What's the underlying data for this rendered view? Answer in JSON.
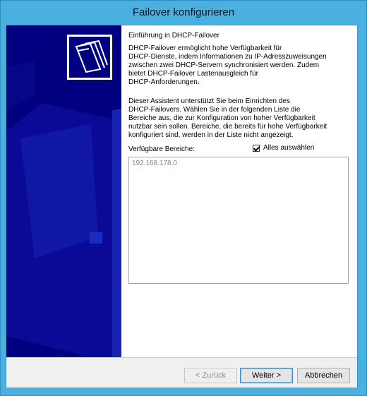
{
  "window": {
    "title": "Failover konfigurieren"
  },
  "intro": {
    "heading": "Einführung in DHCP-Failover",
    "paragraph1_lines": [
      "DHCP-Failover ermöglicht hohe Verfügbarkeit für",
      "DHCP-Dienste, indem Informationen zu IP-Adresszuweisungen",
      "zwischen zwei DHCP-Servern synchronisiert werden. Zudem",
      "bietet DHCP-Failover Lastenausgleich für",
      "DHCP-Anforderungen."
    ],
    "paragraph2_lines": [
      "Dieser Assistent unterstützt Sie beim Einrichten des",
      "DHCP-Failovers. Wählen Sie in der folgenden Liste die",
      "Bereiche aus, die zur Konfiguration von hoher Verfügbarkeit",
      "nutzbar sein sollen. Bereiche, die bereits für hohe Verfügbarkeit",
      "konfiguriert sind, werden in der Liste nicht angezeigt."
    ]
  },
  "scopes": {
    "label": "Verfügbare Bereiche:",
    "select_all_label": "Alles auswählen",
    "select_all_checked": true,
    "items": [
      "192.168.178.0"
    ]
  },
  "buttons": {
    "back": "< Zurück",
    "next": "Weiter >",
    "cancel": "Abbrechen"
  },
  "sidebar": {
    "icon": "folders-icon",
    "background": "#000080"
  }
}
